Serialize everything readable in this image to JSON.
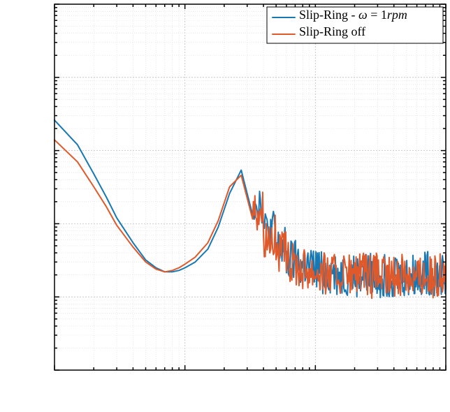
{
  "chart_data": {
    "type": "line",
    "xscale": "log",
    "yscale": "log",
    "xlim": [
      1,
      1000
    ],
    "ylim": [
      1,
      100000
    ],
    "title": "",
    "xlabel": "",
    "ylabel": "",
    "grid": true,
    "legend_position": "upper right",
    "series": [
      {
        "name": "Slip-Ring - ω = 1 rpm",
        "color": "#1778b3",
        "x": [
          1,
          1.5,
          2,
          2.5,
          3,
          4,
          5,
          6,
          7,
          8,
          9,
          10,
          12,
          15,
          18,
          22,
          27,
          33,
          40,
          50,
          60,
          75,
          90,
          110,
          130,
          160,
          200,
          240,
          280,
          330,
          400,
          480,
          560,
          650,
          750,
          870,
          1000
        ],
        "y": [
          2600,
          1200,
          480,
          230,
          120,
          55,
          32,
          25,
          22,
          22,
          23,
          25,
          30,
          45,
          90,
          260,
          540,
          200,
          80,
          45,
          30,
          26,
          24,
          22,
          21,
          20,
          19,
          20,
          19,
          20,
          21,
          19,
          20,
          21,
          20,
          19,
          20
        ],
        "noise_after_x": 30
      },
      {
        "name": "Slip-Ring off",
        "color": "#e0592b",
        "x": [
          1,
          1.5,
          2,
          2.5,
          3,
          4,
          5,
          6,
          7,
          8,
          9,
          10,
          12,
          15,
          18,
          22,
          27,
          33,
          40,
          50,
          60,
          75,
          90,
          110,
          130,
          160,
          200,
          240,
          280,
          330,
          400,
          480,
          560,
          650,
          750,
          870,
          1000
        ],
        "y": [
          1400,
          700,
          320,
          170,
          95,
          48,
          30,
          24,
          22,
          23,
          25,
          28,
          35,
          55,
          110,
          320,
          460,
          160,
          70,
          40,
          28,
          25,
          23,
          21,
          20,
          19,
          20,
          19,
          20,
          19,
          20,
          21,
          19,
          20,
          19,
          20,
          21
        ],
        "noise_after_x": 30
      }
    ]
  },
  "legend": {
    "items": [
      {
        "label_html": "Slip-Ring - <span class='it'>ω</span> = 1<span class='it'>rpm</span>",
        "plain": "Slip-Ring - ω = 1 rpm"
      },
      {
        "label_html": "Slip-Ring off",
        "plain": "Slip-Ring off"
      }
    ]
  }
}
